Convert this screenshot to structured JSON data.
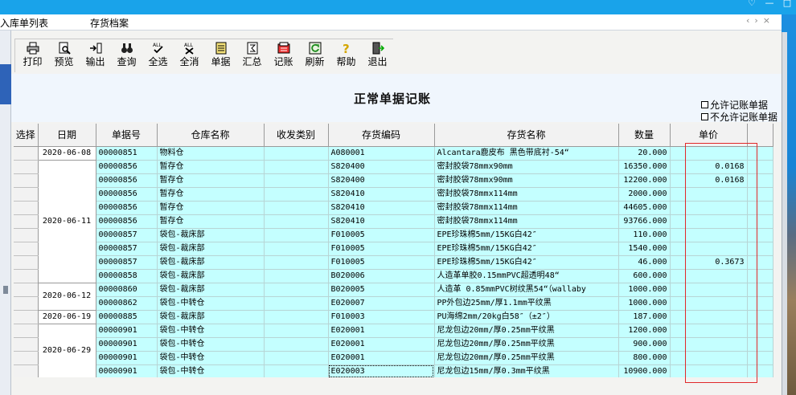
{
  "window": {
    "icons": [
      "♡",
      "—",
      "□"
    ]
  },
  "tabs": [
    {
      "label": "入库单列表"
    },
    {
      "label": "存货档案"
    }
  ],
  "tab_controls": "‹›×",
  "toolbar": [
    {
      "label": "打印",
      "icon": "printer-icon"
    },
    {
      "label": "预览",
      "icon": "preview-icon"
    },
    {
      "label": "输出",
      "icon": "export-icon"
    },
    {
      "label": "查询",
      "icon": "binoculars-icon"
    },
    {
      "label": "全选",
      "icon": "select-all-icon"
    },
    {
      "label": "全消",
      "icon": "deselect-all-icon"
    },
    {
      "label": "单据",
      "icon": "document-icon"
    },
    {
      "label": "汇总",
      "icon": "summary-icon"
    },
    {
      "label": "记账",
      "icon": "ledger-icon"
    },
    {
      "label": "刷新",
      "icon": "refresh-icon"
    },
    {
      "label": "帮助",
      "icon": "help-icon"
    },
    {
      "label": "退出",
      "icon": "exit-icon"
    }
  ],
  "page_title": "正常单据记账",
  "options": {
    "allow": "允许记账单据",
    "disallow": "不允许记账单据"
  },
  "table": {
    "columns": [
      "选择",
      "日期",
      "单据号",
      "仓库名称",
      "收发类别",
      "存货编码",
      "存货名称",
      "数量",
      "单价"
    ],
    "rows": [
      {
        "date": "2020-06-08",
        "span": 1,
        "doc": "00000851",
        "wh": "物料仓",
        "type": "",
        "code": "A080001",
        "name": "Alcantara鹿皮布 黑色带底衬-54“",
        "qty": "20.000",
        "price": ""
      },
      {
        "date": "2020-06-11",
        "span": 9,
        "doc": "00000856",
        "wh": "暂存仓",
        "type": "",
        "code": "S820400",
        "name": "密封胶袋78mmx90mm",
        "qty": "16350.000",
        "price": "0.0168"
      },
      {
        "doc": "00000856",
        "wh": "暂存仓",
        "type": "",
        "code": "S820400",
        "name": "密封胶袋78mmx90mm",
        "qty": "12200.000",
        "price": "0.0168"
      },
      {
        "doc": "00000856",
        "wh": "暂存仓",
        "type": "",
        "code": "S820410",
        "name": "密封胶袋78mmx114mm",
        "qty": "2000.000",
        "price": ""
      },
      {
        "doc": "00000856",
        "wh": "暂存仓",
        "type": "",
        "code": "S820410",
        "name": "密封胶袋78mmx114mm",
        "qty": "44605.000",
        "price": ""
      },
      {
        "doc": "00000856",
        "wh": "暂存仓",
        "type": "",
        "code": "S820410",
        "name": "密封胶袋78mmx114mm",
        "qty": "93766.000",
        "price": ""
      },
      {
        "doc": "00000857",
        "wh": "袋包-裁床部",
        "type": "",
        "code": "F010005",
        "name": "EPE珍珠棉5mm/15KG白42″",
        "qty": "110.000",
        "price": ""
      },
      {
        "doc": "00000857",
        "wh": "袋包-裁床部",
        "type": "",
        "code": "F010005",
        "name": "EPE珍珠棉5mm/15KG白42″",
        "qty": "1540.000",
        "price": ""
      },
      {
        "doc": "00000857",
        "wh": "袋包-裁床部",
        "type": "",
        "code": "F010005",
        "name": "EPE珍珠棉5mm/15KG白42″",
        "qty": "46.000",
        "price": "0.3673"
      },
      {
        "doc": "00000858",
        "wh": "袋包-裁床部",
        "type": "",
        "code": "B020006",
        "name": "人造革单胶0.15mmPVC超透明48“",
        "qty": "600.000",
        "price": ""
      },
      {
        "date": "2020-06-12",
        "span": 2,
        "doc": "00000860",
        "wh": "袋包-裁床部",
        "type": "",
        "code": "B020005",
        "name": "人造革 0.85mmPVC树纹黑54“（wallaby",
        "qty": "1000.000",
        "price": ""
      },
      {
        "doc": "00000862",
        "wh": "袋包-中转仓",
        "type": "",
        "code": "E020007",
        "name": "PP外包边25mm/厚1.1mm平纹黑",
        "qty": "1000.000",
        "price": ""
      },
      {
        "date": "2020-06-19",
        "span": 1,
        "doc": "00000885",
        "wh": "袋包-裁床部",
        "type": "",
        "code": "F010003",
        "name": "PU海绵2mm/20kg白58″（±2″）",
        "qty": "187.000",
        "price": ""
      },
      {
        "date": "2020-06-29",
        "span": 4,
        "doc": "00000901",
        "wh": "袋包-中转仓",
        "type": "",
        "code": "E020001",
        "name": "尼龙包边20mm/厚0.25mm平纹黑",
        "qty": "1200.000",
        "price": ""
      },
      {
        "doc": "00000901",
        "wh": "袋包-中转仓",
        "type": "",
        "code": "E020001",
        "name": "尼龙包边20mm/厚0.25mm平纹黑",
        "qty": "900.000",
        "price": ""
      },
      {
        "doc": "00000901",
        "wh": "袋包-中转仓",
        "type": "",
        "code": "E020001",
        "name": "尼龙包边20mm/厚0.25mm平纹黑",
        "qty": "800.000",
        "price": ""
      },
      {
        "doc": "00000901",
        "wh": "袋包-中转仓",
        "type": "",
        "code": "E020003",
        "name": "尼龙包边15mm/厚0.3mm平纹黑",
        "qty": "10900.000",
        "price": ""
      }
    ]
  },
  "colors": {
    "titlebar": "#19a3ea",
    "row_bg": "#c4ffff",
    "highlight_box": "#e0282a"
  }
}
